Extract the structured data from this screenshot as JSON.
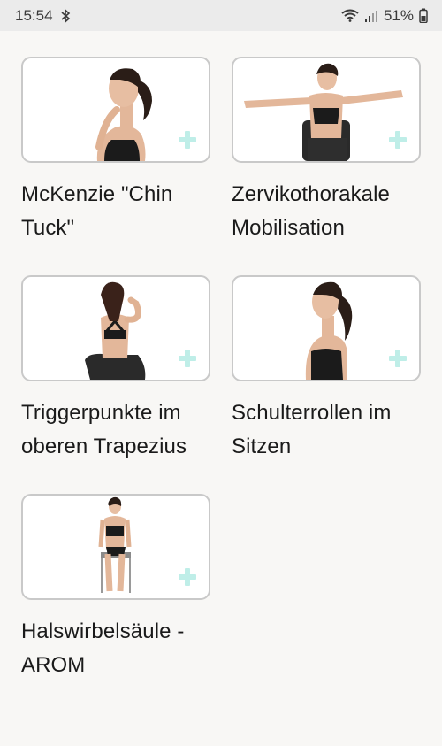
{
  "status_bar": {
    "time": "15:54",
    "battery": "51%",
    "icons": [
      "bluetooth-icon",
      "wifi-icon",
      "signal-icon",
      "battery-icon"
    ]
  },
  "exercises": [
    {
      "title": "McKenzie \"Chin Tuck\"",
      "action_icon": "plus-icon"
    },
    {
      "title": "Zervikothorakale Mobilisation",
      "action_icon": "plus-icon"
    },
    {
      "title": "Triggerpunkte im oberen Trapezius",
      "action_icon": "plus-icon"
    },
    {
      "title": "Schulterrollen im Sitzen",
      "action_icon": "plus-icon"
    },
    {
      "title": "Halswirbelsäule - AROM",
      "action_icon": "plus-icon"
    }
  ],
  "colors": {
    "accent_plus": "#bfeee8",
    "background": "#f8f7f5",
    "status_bar": "#ebebeb"
  }
}
